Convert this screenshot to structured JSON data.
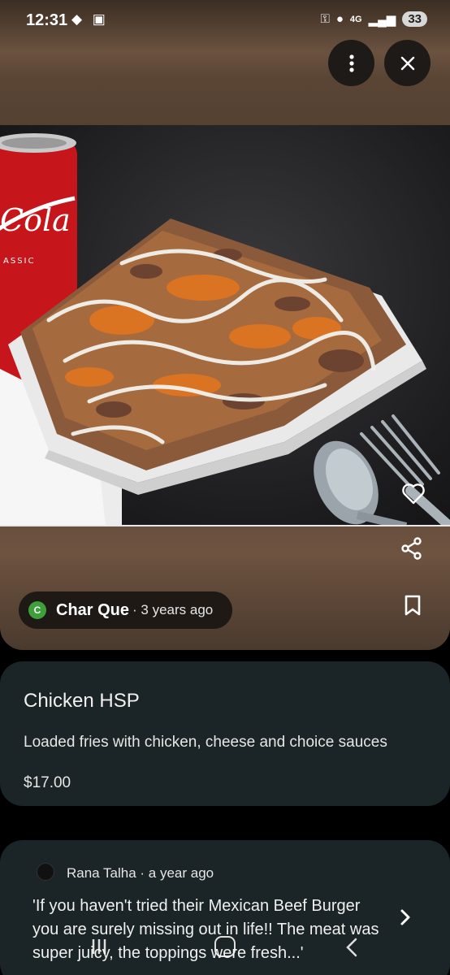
{
  "status_bar": {
    "time": "12:31",
    "network": "4G",
    "battery": "33"
  },
  "header": {
    "more_icon": "more-vertical-icon",
    "close_icon": "close-icon"
  },
  "image": {
    "description_icon": "food-photo",
    "can_label": "Coca-Cola Classic"
  },
  "source": {
    "avatar_letter": "C",
    "name": "Char Que",
    "time": "· 3 years ago"
  },
  "item": {
    "title": "Chicken HSP",
    "description": "Loaded fries with chicken, cheese and choice sauces",
    "price": "$17.00"
  },
  "review": {
    "author_meta": "Rana Talha · a year ago",
    "text": "'If you haven't tried their Mexican Beef Burger you are surely missing out in life!! The meat was super juicy, the toppings were fresh...'"
  },
  "colors": {
    "card_bg": "#1b2426",
    "source_avatar": "#3f9f3a"
  }
}
